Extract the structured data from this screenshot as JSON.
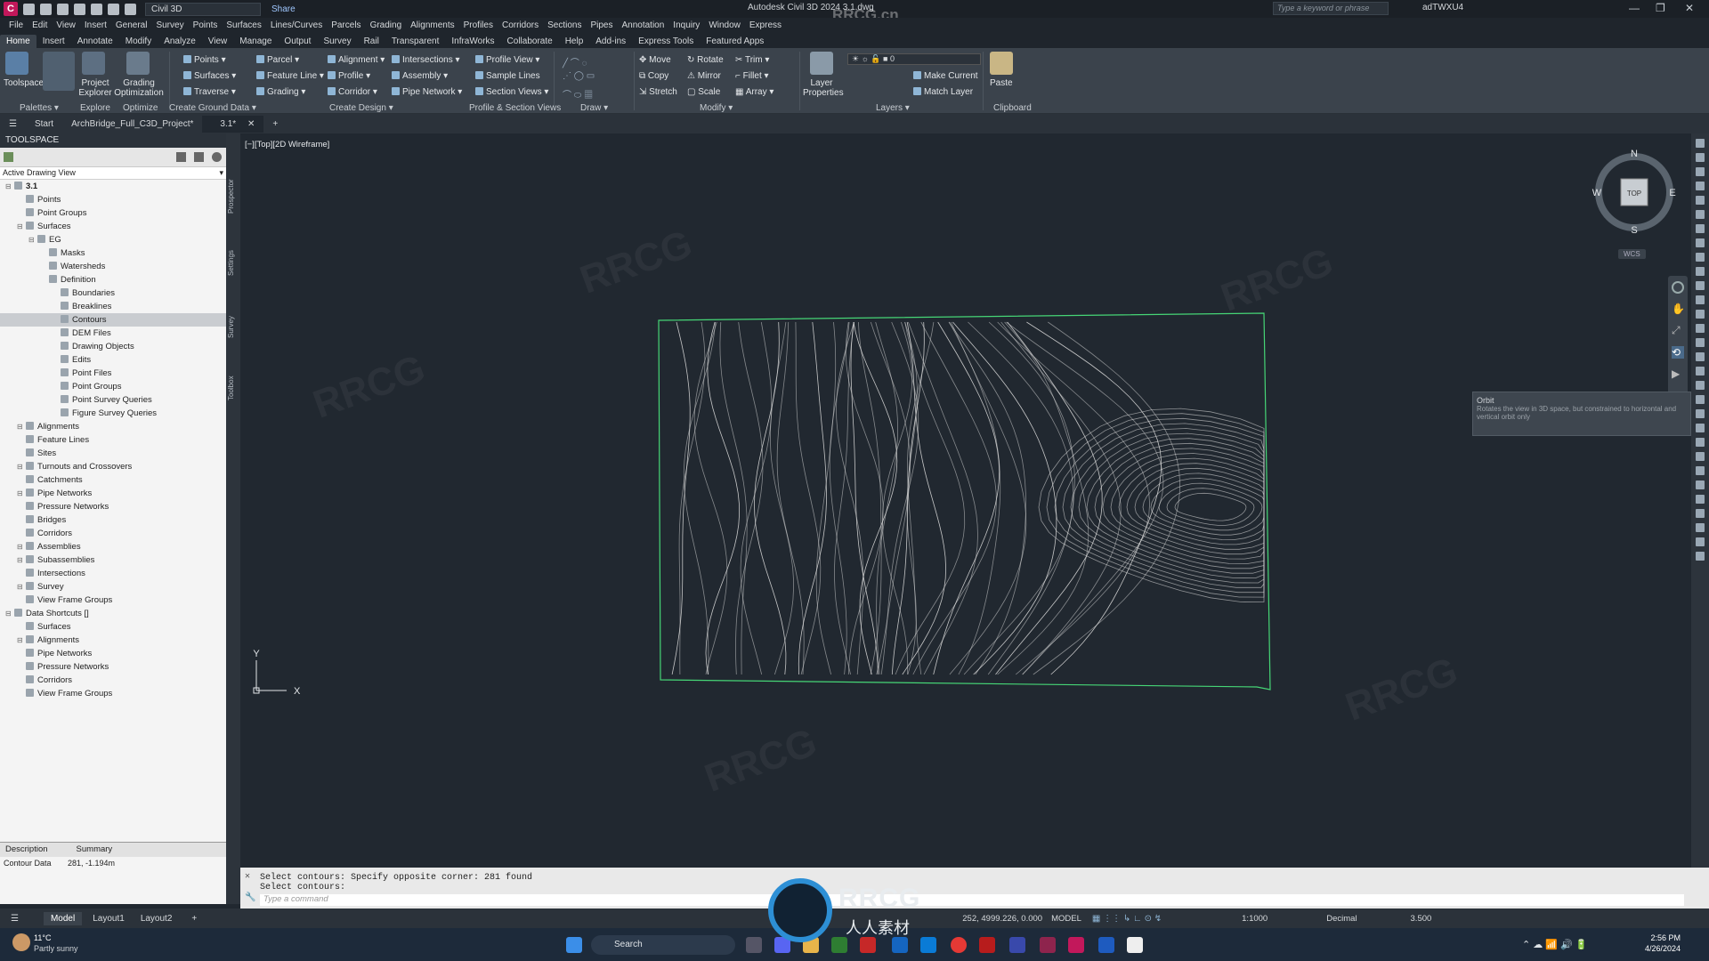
{
  "titlebar": {
    "workspace": "Civil 3D",
    "share": "Share",
    "app_title": "Autodesk Civil 3D 2024   3.1.dwg",
    "search_placeholder": "Type a keyword or phrase",
    "user": "adTWXU4",
    "watermark": "RRCG.cn"
  },
  "menu": [
    "File",
    "Edit",
    "View",
    "Insert",
    "General",
    "Survey",
    "Points",
    "Surfaces",
    "Lines/Curves",
    "Parcels",
    "Grading",
    "Alignments",
    "Profiles",
    "Corridors",
    "Sections",
    "Pipes",
    "Annotation",
    "Inquiry",
    "Window",
    "Express"
  ],
  "tabs": [
    "Home",
    "Insert",
    "Annotate",
    "Modify",
    "Analyze",
    "View",
    "Manage",
    "Output",
    "Survey",
    "Rail",
    "Transparent",
    "InfraWorks",
    "Collaborate",
    "Help",
    "Add-ins",
    "Express Tools",
    "Featured Apps"
  ],
  "ribbon": {
    "toolspace": "Toolspace",
    "project_explorer": "Project Explorer",
    "grading_opt": "Grading Optimization",
    "points": "Points",
    "surfaces": "Surfaces",
    "traverse": "Traverse",
    "parcel": "Parcel",
    "feature_line": "Feature Line",
    "grading": "Grading",
    "alignment": "Alignment",
    "profile": "Profile",
    "corridor": "Corridor",
    "intersections": "Intersections",
    "assembly": "Assembly",
    "pipe_network": "Pipe Network",
    "profile_view": "Profile View",
    "sample_lines": "Sample Lines",
    "section_views": "Section Views",
    "move": "Move",
    "copy": "Copy",
    "stretch": "Stretch",
    "rotate": "Rotate",
    "mirror": "Mirror",
    "scale": "Scale",
    "trim": "Trim",
    "fillet": "Fillet",
    "array": "Array",
    "layer_props": "Layer Properties",
    "layer_value": "0",
    "make_current": "Make Current",
    "match_layer": "Match Layer",
    "paste": "Paste",
    "panels": {
      "palettes": "Palettes",
      "explore": "Explore",
      "optimize": "Optimize",
      "create_ground": "Create Ground Data",
      "create_design": "Create Design",
      "profile_section": "Profile & Section Views",
      "draw": "Draw",
      "modify": "Modify",
      "layers": "Layers",
      "clipboard": "Clipboard"
    }
  },
  "doctabs": {
    "start": "Start",
    "project": "ArchBridge_Full_C3D_Project*",
    "current": "3.1*"
  },
  "toolspace": {
    "title": "TOOLSPACE",
    "view": "Active Drawing View",
    "tree": [
      {
        "l": 0,
        "t": "3.1",
        "b": 1
      },
      {
        "l": 1,
        "t": "Points"
      },
      {
        "l": 1,
        "t": "Point Groups"
      },
      {
        "l": 1,
        "t": "Surfaces"
      },
      {
        "l": 2,
        "t": "EG"
      },
      {
        "l": 3,
        "t": "Masks"
      },
      {
        "l": 3,
        "t": "Watersheds"
      },
      {
        "l": 3,
        "t": "Definition"
      },
      {
        "l": 4,
        "t": "Boundaries"
      },
      {
        "l": 4,
        "t": "Breaklines"
      },
      {
        "l": 4,
        "t": "Contours",
        "s": 1
      },
      {
        "l": 4,
        "t": "DEM Files"
      },
      {
        "l": 4,
        "t": "Drawing Objects"
      },
      {
        "l": 4,
        "t": "Edits"
      },
      {
        "l": 4,
        "t": "Point Files"
      },
      {
        "l": 4,
        "t": "Point Groups"
      },
      {
        "l": 4,
        "t": "Point Survey Queries"
      },
      {
        "l": 4,
        "t": "Figure Survey Queries"
      },
      {
        "l": 1,
        "t": "Alignments"
      },
      {
        "l": 1,
        "t": "Feature Lines"
      },
      {
        "l": 1,
        "t": "Sites"
      },
      {
        "l": 1,
        "t": "Turnouts and Crossovers"
      },
      {
        "l": 1,
        "t": "Catchments"
      },
      {
        "l": 1,
        "t": "Pipe Networks"
      },
      {
        "l": 1,
        "t": "Pressure Networks"
      },
      {
        "l": 1,
        "t": "Bridges"
      },
      {
        "l": 1,
        "t": "Corridors"
      },
      {
        "l": 1,
        "t": "Assemblies"
      },
      {
        "l": 1,
        "t": "Subassemblies"
      },
      {
        "l": 1,
        "t": "Intersections"
      },
      {
        "l": 1,
        "t": "Survey"
      },
      {
        "l": 1,
        "t": "View Frame Groups"
      },
      {
        "l": 0,
        "t": "Data Shortcuts []"
      },
      {
        "l": 1,
        "t": "Surfaces"
      },
      {
        "l": 1,
        "t": "Alignments"
      },
      {
        "l": 1,
        "t": "Pipe Networks"
      },
      {
        "l": 1,
        "t": "Pressure Networks"
      },
      {
        "l": 1,
        "t": "Corridors"
      },
      {
        "l": 1,
        "t": "View Frame Groups"
      }
    ],
    "vtabs": [
      "Prospector",
      "Settings",
      "Survey",
      "Toolbox"
    ],
    "desc_headers": [
      "Description",
      "Summary"
    ],
    "desc_row": [
      "Contour Data",
      "281, -1.194m"
    ]
  },
  "viewport": {
    "label": "[−][Top][2D Wireframe]",
    "compass": {
      "n": "N",
      "s": "S",
      "e": "E",
      "w": "W",
      "top": "TOP"
    },
    "wcs": "WCS",
    "tooltip_title": "Orbit",
    "tooltip_text": "Rotates the view in 3D space, but constrained to horizontal and vertical orbit only",
    "ucs_x": "X",
    "ucs_y": "Y"
  },
  "command": {
    "line1": "Select contours: Specify opposite corner: 281 found",
    "line2": "Select contours:",
    "placeholder": "Type a command"
  },
  "status": {
    "model": "Model",
    "layout1": "Layout1",
    "layout2": "Layout2",
    "coords": "252, 4999.226, 0.000",
    "space": "MODEL",
    "scale": "1:1000",
    "units": "Decimal",
    "value": "3.500"
  },
  "taskbar": {
    "temp": "11°C",
    "weather": "Partly sunny",
    "search": "Search",
    "time": "2:56 PM",
    "date": "4/26/2024",
    "brand": "RRCG",
    "brand_sub": "人人素材"
  },
  "colors": {
    "accent": "#4fc3f7",
    "boundary": "#46d676",
    "contour": "#d8d8d8"
  }
}
